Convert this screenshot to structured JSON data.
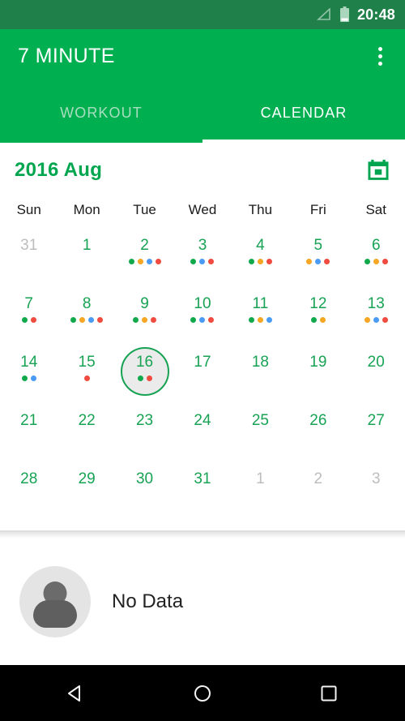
{
  "status_bar": {
    "time": "20:48",
    "signal_icon": "signal-triangle-icon",
    "battery_icon": "battery-icon",
    "background_color": "#20804a"
  },
  "app_bar": {
    "title": "7 MINUTE",
    "overflow_icon": "kebab-menu-icon",
    "background_color": "#00b050"
  },
  "tabs": {
    "items": [
      {
        "label": "WORKOUT",
        "active": false
      },
      {
        "label": "CALENDAR",
        "active": true
      }
    ],
    "active_index": 1,
    "indicator_color": "#ffffff",
    "inactive_color": "#a8dec0"
  },
  "calendar": {
    "month_label": "2016 Aug",
    "month_color": "#00a64f",
    "today_button_icon": "calendar-today-icon",
    "weekdays": [
      "Sun",
      "Mon",
      "Tue",
      "Wed",
      "Thu",
      "Fri",
      "Sat"
    ],
    "selected_day": 16,
    "dot_colors": {
      "green": "#12a84c",
      "orange": "#f5a623",
      "blue": "#4a9bf5",
      "red": "#ef4b3f"
    },
    "weeks": [
      [
        {
          "label": "31",
          "muted": true,
          "dots": []
        },
        {
          "label": "1",
          "muted": false,
          "dots": []
        },
        {
          "label": "2",
          "muted": false,
          "dots": [
            "green",
            "orange",
            "blue",
            "red"
          ]
        },
        {
          "label": "3",
          "muted": false,
          "dots": [
            "green",
            "blue",
            "red"
          ]
        },
        {
          "label": "4",
          "muted": false,
          "dots": [
            "green",
            "orange",
            "red"
          ]
        },
        {
          "label": "5",
          "muted": false,
          "dots": [
            "orange",
            "blue",
            "red"
          ]
        },
        {
          "label": "6",
          "muted": false,
          "dots": [
            "green",
            "orange",
            "red"
          ]
        }
      ],
      [
        {
          "label": "7",
          "muted": false,
          "dots": [
            "green",
            "red"
          ]
        },
        {
          "label": "8",
          "muted": false,
          "dots": [
            "green",
            "orange",
            "blue",
            "red"
          ]
        },
        {
          "label": "9",
          "muted": false,
          "dots": [
            "green",
            "orange",
            "red"
          ]
        },
        {
          "label": "10",
          "muted": false,
          "dots": [
            "green",
            "blue",
            "red"
          ]
        },
        {
          "label": "11",
          "muted": false,
          "dots": [
            "green",
            "orange",
            "blue"
          ]
        },
        {
          "label": "12",
          "muted": false,
          "dots": [
            "green",
            "orange"
          ]
        },
        {
          "label": "13",
          "muted": false,
          "dots": [
            "orange",
            "blue",
            "red"
          ]
        }
      ],
      [
        {
          "label": "14",
          "muted": false,
          "dots": [
            "green",
            "blue"
          ]
        },
        {
          "label": "15",
          "muted": false,
          "dots": [
            "red"
          ]
        },
        {
          "label": "16",
          "muted": false,
          "dots": [
            "green",
            "red"
          ],
          "selected": true
        },
        {
          "label": "17",
          "muted": false,
          "dots": []
        },
        {
          "label": "18",
          "muted": false,
          "dots": []
        },
        {
          "label": "19",
          "muted": false,
          "dots": []
        },
        {
          "label": "20",
          "muted": false,
          "dots": []
        }
      ],
      [
        {
          "label": "21",
          "muted": false,
          "dots": []
        },
        {
          "label": "22",
          "muted": false,
          "dots": []
        },
        {
          "label": "23",
          "muted": false,
          "dots": []
        },
        {
          "label": "24",
          "muted": false,
          "dots": []
        },
        {
          "label": "25",
          "muted": false,
          "dots": []
        },
        {
          "label": "26",
          "muted": false,
          "dots": []
        },
        {
          "label": "27",
          "muted": false,
          "dots": []
        }
      ],
      [
        {
          "label": "28",
          "muted": false,
          "dots": []
        },
        {
          "label": "29",
          "muted": false,
          "dots": []
        },
        {
          "label": "30",
          "muted": false,
          "dots": []
        },
        {
          "label": "31",
          "muted": false,
          "dots": []
        },
        {
          "label": "1",
          "muted": true,
          "dots": []
        },
        {
          "label": "2",
          "muted": true,
          "dots": []
        },
        {
          "label": "3",
          "muted": true,
          "dots": []
        }
      ]
    ]
  },
  "detail": {
    "avatar_icon": "user-avatar-placeholder-icon",
    "message": "No Data"
  },
  "nav_bar": {
    "back_icon": "back-triangle-icon",
    "home_icon": "home-circle-icon",
    "recents_icon": "recents-square-icon",
    "background_color": "#000000"
  }
}
